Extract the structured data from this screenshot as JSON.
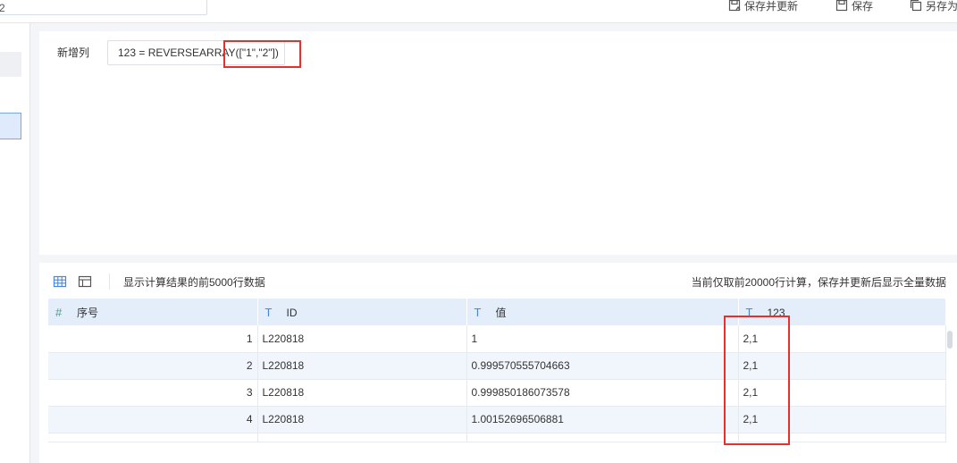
{
  "toolbar": {
    "top_input_value": "2",
    "save_update_label": "保存并更新",
    "save_label": "保存",
    "save_as_label": "另存为"
  },
  "formula": {
    "label": "新增列",
    "expression": "123 = REVERSEARRAY([\"1\",\"2\"])"
  },
  "preview": {
    "note_left": "显示计算结果的前5000行数据",
    "note_right": "当前仅取前20000行计算，保存并更新后显示全量数据",
    "columns": [
      {
        "name": "序号",
        "icon": "hash-icon"
      },
      {
        "name": "ID",
        "icon": "text-type-icon"
      },
      {
        "name": "值",
        "icon": "text-type-icon"
      },
      {
        "name": "123",
        "icon": "text-type-icon"
      }
    ],
    "rows": [
      {
        "seq": "1",
        "id": "L220818",
        "value": "1",
        "result": "2,1"
      },
      {
        "seq": "2",
        "id": "L220818",
        "value": "0.999570555704663",
        "result": "2,1"
      },
      {
        "seq": "3",
        "id": "L220818",
        "value": "0.999850186073578",
        "result": "2,1"
      },
      {
        "seq": "4",
        "id": "L220818",
        "value": "1.00152696506881",
        "result": "2,1"
      }
    ]
  },
  "colors": {
    "highlight": "#e5312b",
    "header_bg": "#e4edfa",
    "accent": "#4a86e0"
  }
}
